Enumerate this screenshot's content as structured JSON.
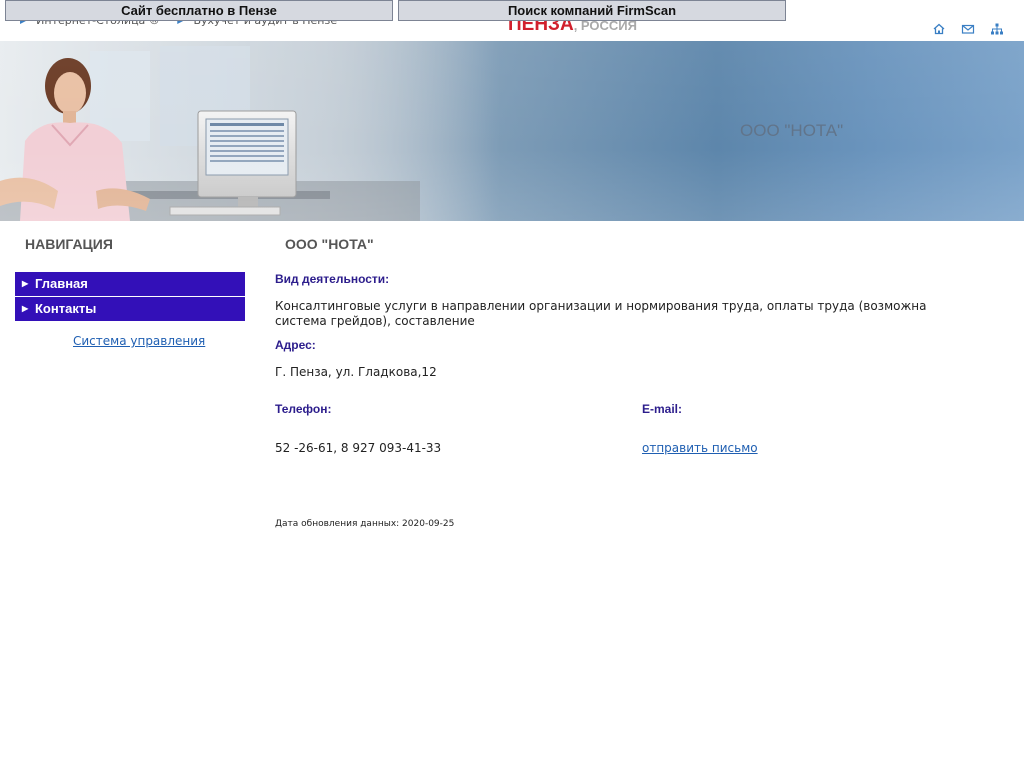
{
  "promos": {
    "site_free": "Сайт бесплатно в Пензе",
    "search": "Поиск компаний FirmScan"
  },
  "breadcrumbs": [
    "Интернет-Столица ®",
    "Бухучет и аудит в Пензе"
  ],
  "city": {
    "name": "ПЕНЗА",
    "country": ", РОССИЯ"
  },
  "top_icons": [
    "home-icon",
    "mail-icon",
    "sitemap-icon"
  ],
  "banner": {
    "title": "ООО \"НОТА\""
  },
  "sidebar": {
    "title": "НАВИГАЦИЯ",
    "items": [
      {
        "label": "Главная"
      },
      {
        "label": "Контакты"
      }
    ],
    "admin_link": "Система управления"
  },
  "main": {
    "title": "ООО \"НОТА\"",
    "activity_label": "Вид деятельности:",
    "activity_text": "Консалтинговые услуги в направлении организации и нормирования труда, оплаты труда (возможна система грейдов), составление",
    "address_label": "Адрес:",
    "address_text": "Г. Пенза, ул. Гладкова,12",
    "phone_label": "Телефон:",
    "phone_text": "52 -26-61, 8 927 093-41-33",
    "email_label": "E-mail:",
    "email_link": "отправить письмо",
    "updated": "Дата обновления данных: 2020-09-25"
  },
  "colors": {
    "nav_bg": "#3310b8",
    "label": "#2c1d8c",
    "link": "#1f5fb2",
    "city": "#d1202d"
  }
}
